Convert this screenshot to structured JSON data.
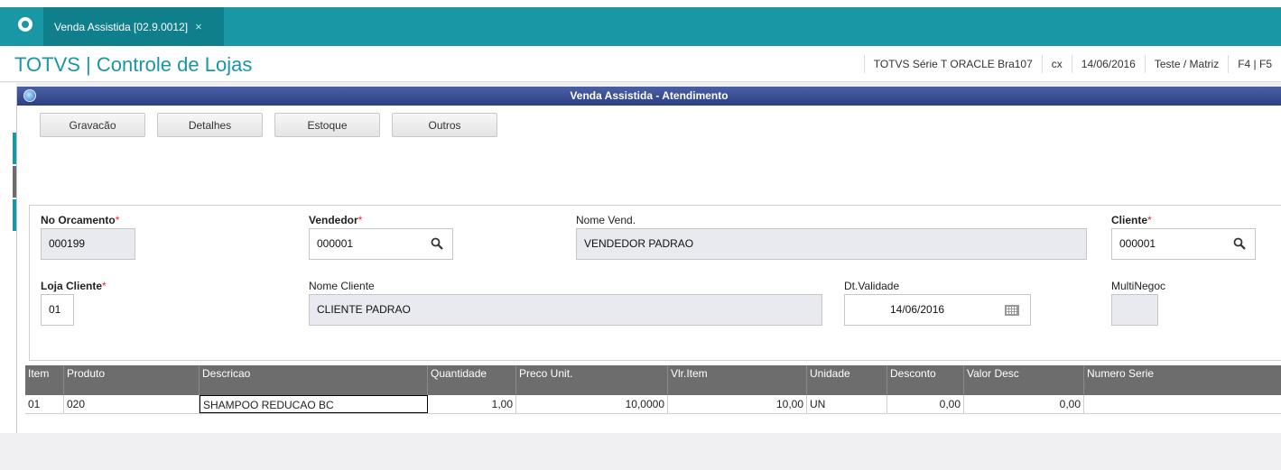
{
  "tabbar": {
    "tab_title": "Venda Assistida [02.9.0012]",
    "close_glyph": "×"
  },
  "header": {
    "title": "TOTVS | Controle de Lojas",
    "info": [
      "TOTVS Série T  ORACLE Bra107",
      "cx",
      "14/06/2016",
      "Teste / Matriz",
      "F4 | F5"
    ]
  },
  "window": {
    "title": "Venda Assistida - Atendimento"
  },
  "buttons": [
    "Gravacão",
    "Detalhes",
    "Estoque",
    "Outros"
  ],
  "form": {
    "no_orcamento": {
      "label": "No Orcamento",
      "value": "000199"
    },
    "vendedor": {
      "label": "Vendedor",
      "value": "000001"
    },
    "nome_vend": {
      "label": "Nome Vend.",
      "value": "VENDEDOR PADRAO"
    },
    "cliente": {
      "label": "Cliente",
      "value": "000001"
    },
    "loja_cliente": {
      "label": "Loja Cliente",
      "value": "01"
    },
    "nome_cliente": {
      "label": "Nome Cliente",
      "value": "CLIENTE PADRAO"
    },
    "dt_validade": {
      "label": "Dt.Validade",
      "value": "14/06/2016"
    },
    "multinegoc": {
      "label": "MultiNegoc",
      "value": ""
    },
    "required_mark": "*"
  },
  "grid": {
    "columns": [
      "Item",
      "Produto",
      "Descricao",
      "Quantidade",
      "Preco Unit.",
      "Vlr.Item",
      "Unidade",
      "Desconto",
      "Valor Desc",
      "Numero Serie"
    ],
    "rows": [
      [
        "01",
        "020",
        "SHAMPOO REDUCAO BC",
        "1,00",
        "10,0000",
        "10,00",
        "UN",
        "0,00",
        "0,00",
        ""
      ]
    ]
  },
  "icons": {
    "search": "search-icon",
    "calendar": "calendar-icon",
    "app_logo": "totvs-logo-icon",
    "window": "window-app-icon"
  },
  "colors": {
    "accent": "#1a97a5",
    "window_title": "#2e3f82",
    "grid_header": "#6d6d6d",
    "required": "#e23333"
  }
}
